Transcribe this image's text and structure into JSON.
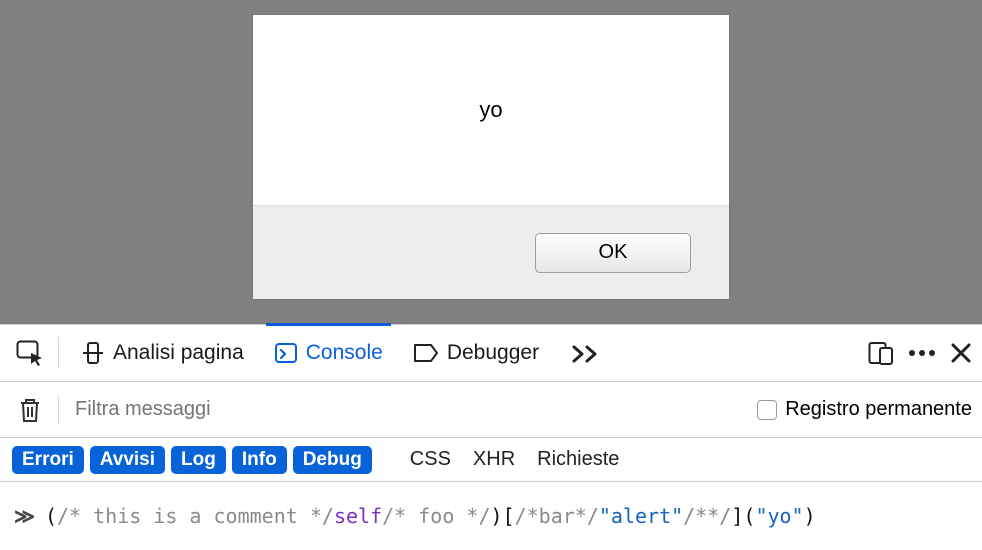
{
  "alert": {
    "message": "yo",
    "ok_label": "OK"
  },
  "tabs": {
    "inspector": "Analisi pagina",
    "console": "Console",
    "debugger": "Debugger"
  },
  "filter": {
    "placeholder": "Filtra messaggi",
    "persist_label": "Registro permanente"
  },
  "levels": {
    "errors": "Errori",
    "warnings": "Avvisi",
    "log": "Log",
    "info": "Info",
    "debug": "Debug",
    "css": "CSS",
    "xhr": "XHR",
    "requests": "Richieste"
  },
  "console": {
    "prompt": "≫",
    "tokens": {
      "c1": "/* this is a comment */",
      "self": "self",
      "c2": "/* foo */",
      "c3": "/*bar*/",
      "s1": "\"alert\"",
      "c4": "/**/",
      "s2": "\"yo\""
    }
  }
}
